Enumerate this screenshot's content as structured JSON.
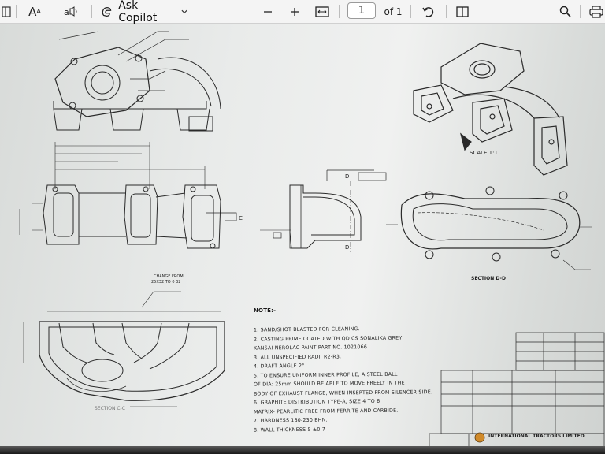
{
  "toolbar": {
    "ask_copilot_label": "Ask Copilot",
    "font_button_label": "A",
    "current_page": "1",
    "page_total_label": "of 1"
  },
  "drawing": {
    "scale_label": "SCALE 1:1",
    "section_dd_label": "SECTION D-D",
    "section_cc_label": "SECTION C-C",
    "change_label": "CHANGE FROM",
    "change_label_2": "25X32 TO 0 32",
    "label_c": "C",
    "label_d_top": "D",
    "label_d_bottom": "D",
    "notes_title": "NOTE:-",
    "notes": [
      "1. SAND/SHOT BLASTED FOR CLEANING.",
      "2. CASTING PRIME COATED WITH QD CS SONALIKA GREY,",
      "   KANSAI NEROLAC PAINT PART NO. 1021066.",
      "3. ALL UNSPECIFIED RADII R2-R3.",
      "4. DRAFT ANGLE 2°.",
      "5. TO ENSURE UNIFORM INNER PROFILE, A STEEL BALL",
      "   OF DIA: 25mm SHOULD BE ABLE TO MOVE FREELY IN THE",
      "   BODY OF EXHAUST FLANGE, WHEN INSERTED FROM SILENCER SIDE.",
      "6. GRAPHITE DISTRIBUTION TYPE-A, SIZE 4 TO 6",
      "   MATRIX- PEARLITIC FREE FROM FERRITE AND CARBIDE.",
      "7. HARDNESS 180-230 BHN.",
      "8. WALL THICKNESS 5 ±0.7"
    ],
    "company_name": "INTERNATIONAL TRACTORS LIMITED"
  }
}
